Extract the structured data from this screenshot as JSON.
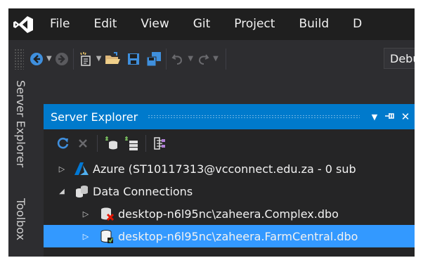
{
  "menu": {
    "items": [
      "File",
      "Edit",
      "View",
      "Git",
      "Project",
      "Build",
      "D"
    ]
  },
  "toolbar": {
    "config_value": "Debu"
  },
  "side_tabs": {
    "server_explorer": "Server Explorer",
    "toolbox": "Toolbox"
  },
  "panel": {
    "title": "Server Explorer",
    "pin_glyph": "⊣",
    "close_glyph": "✕",
    "dropdown_glyph": "▼"
  },
  "tree": {
    "azure": "Azure (ST10117313@vcconnect.edu.za - 0 sub",
    "data_connections": "Data Connections",
    "conn_complex": "desktop-n6l95nc\\zaheera.Complex.dbo",
    "conn_farmcentral": "desktop-n6l95nc\\zaheera.FarmCentral.dbo"
  },
  "colors": {
    "accent": "#007acc",
    "selection": "#3399ff",
    "menubar": "#1f1f1f",
    "chrome": "#2d2d30"
  }
}
